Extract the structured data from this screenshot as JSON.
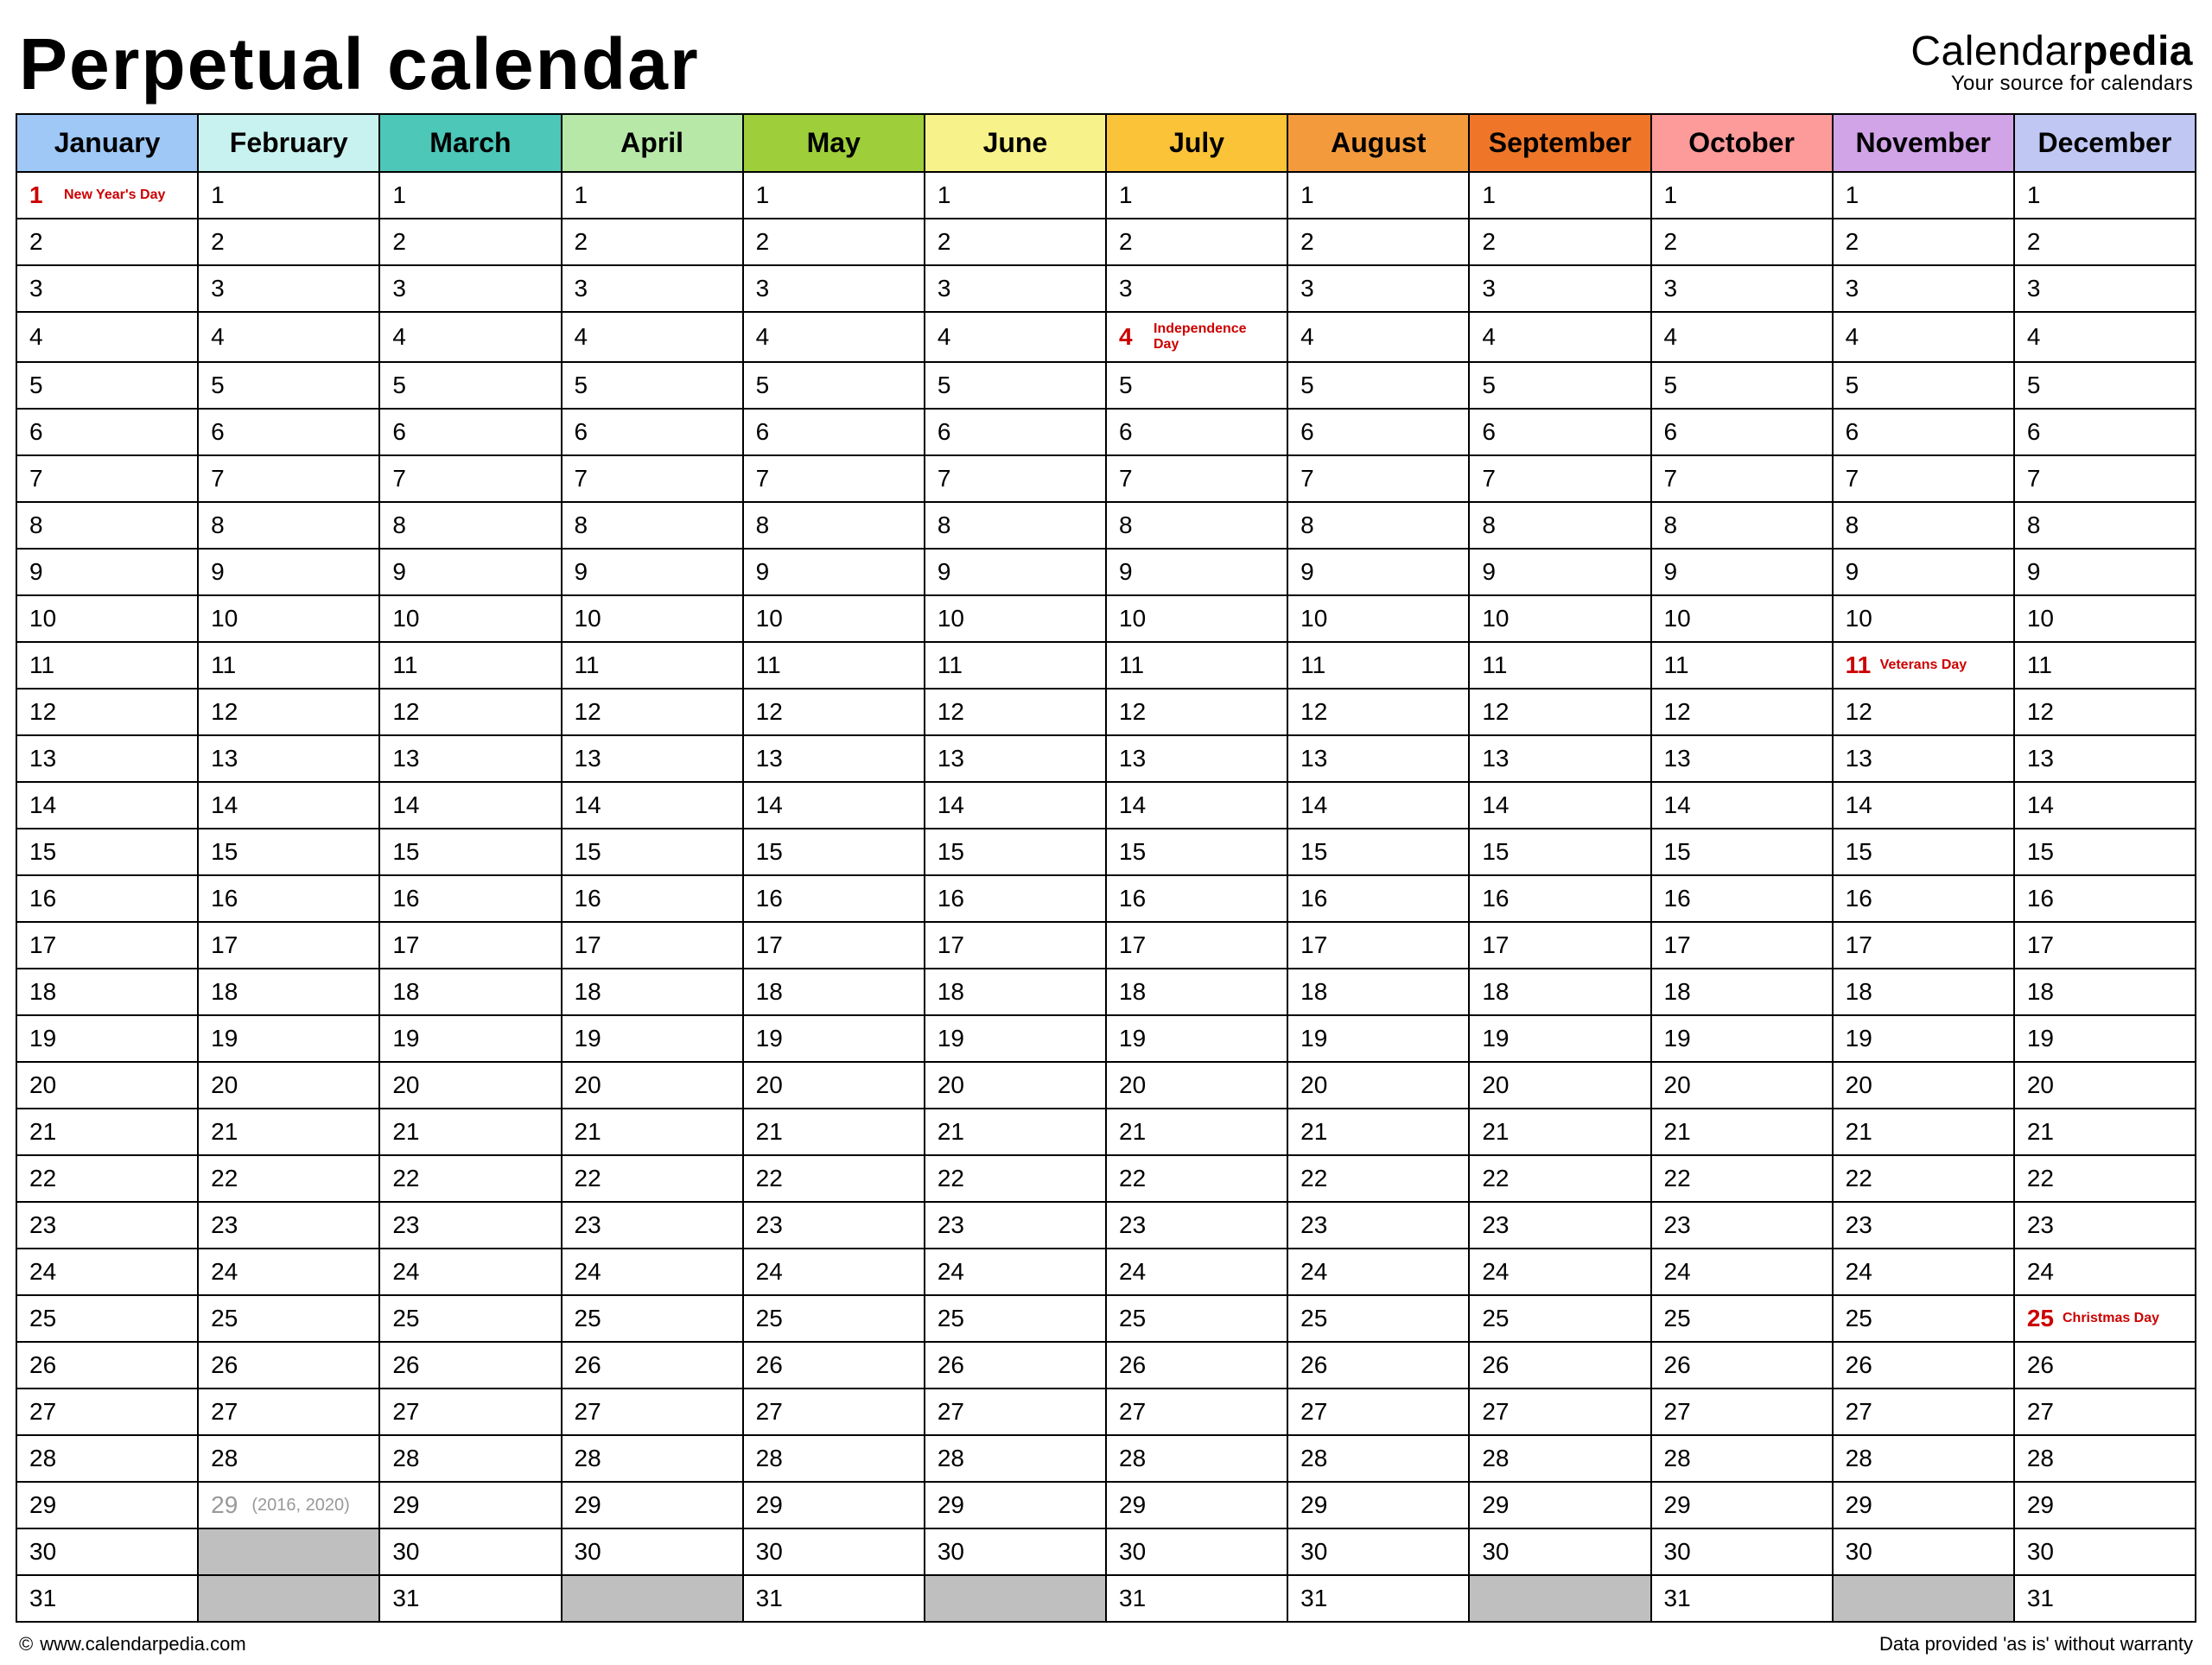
{
  "header": {
    "title": "Perpetual calendar",
    "brand_prefix": "Calendar",
    "brand_suffix": "pedia",
    "brand_tagline": "Your source for calendars"
  },
  "months": [
    {
      "name": "January",
      "color": "#9fc8f7",
      "days": 31
    },
    {
      "name": "February",
      "color": "#c8f2ef",
      "days": 28,
      "leap_day": 29,
      "leap_note": "(2016, 2020)"
    },
    {
      "name": "March",
      "color": "#4cc7b8",
      "days": 31
    },
    {
      "name": "April",
      "color": "#b8e8a8",
      "days": 30
    },
    {
      "name": "May",
      "color": "#9ecf3a",
      "days": 31
    },
    {
      "name": "June",
      "color": "#f8f28a",
      "days": 30
    },
    {
      "name": "July",
      "color": "#fbc337",
      "days": 31
    },
    {
      "name": "August",
      "color": "#f39a3c",
      "days": 31
    },
    {
      "name": "September",
      "color": "#ef7628",
      "days": 30
    },
    {
      "name": "October",
      "color": "#fd9a9a",
      "days": 31
    },
    {
      "name": "November",
      "color": "#d1a4e8",
      "days": 30
    },
    {
      "name": "December",
      "color": "#bfc7f2",
      "days": 31
    }
  ],
  "max_rows": 31,
  "holidays": [
    {
      "month": 0,
      "day": 1,
      "label": "New Year's Day"
    },
    {
      "month": 6,
      "day": 4,
      "label": "Independence Day"
    },
    {
      "month": 10,
      "day": 11,
      "label": "Veterans Day"
    },
    {
      "month": 11,
      "day": 25,
      "label": "Christmas Day"
    }
  ],
  "footer": {
    "copyright_symbol": "©",
    "url": "www.calendarpedia.com",
    "disclaimer": "Data provided 'as is' without warranty"
  }
}
